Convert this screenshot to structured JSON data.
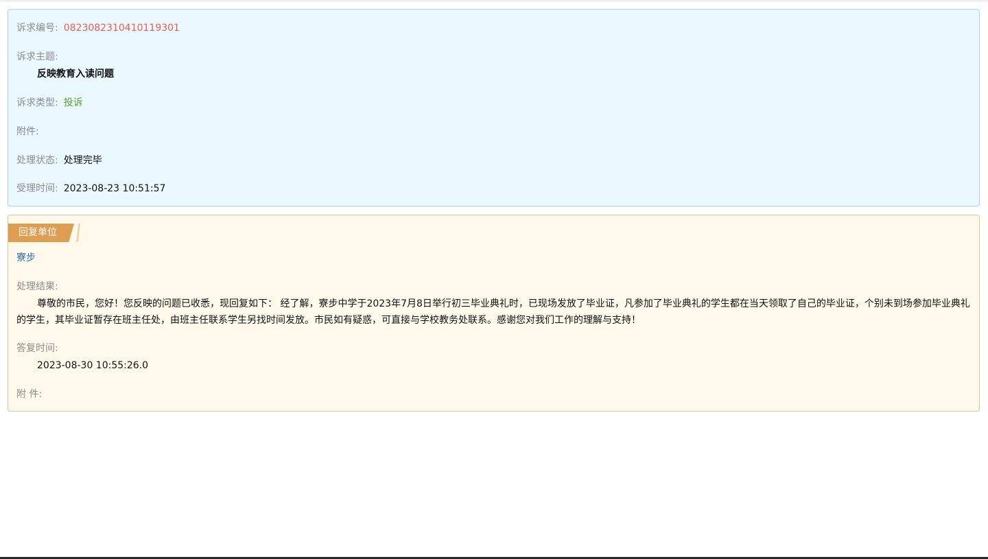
{
  "info": {
    "id_label": "诉求编号:",
    "id_value": "0823082310410119301",
    "subject_label": "诉求主题:",
    "subject_value": "反映教育入读问题",
    "type_label": "诉求类型:",
    "type_value": "投诉",
    "attachment_label": "附件:",
    "status_label": "处理状态:",
    "status_value": "处理完毕",
    "accepted_label": "受理时间:",
    "accepted_value": "2023-08-23 10:51:57"
  },
  "reply": {
    "ribbon_label": "回复单位",
    "unit_name": "寮步",
    "result_label": "处理结果:",
    "result_text": "尊敬的市民，您好！您反映的问题已收悉，现回复如下： 经了解，寮步中学于2023年7月8日举行初三毕业典礼时，已现场发放了毕业证，凡参加了毕业典礼的学生都在当天领取了自己的毕业证，个别未到场参加毕业典礼的学生，其毕业证暂存在班主任处，由班主任联系学生另找时间发放。市民如有疑惑，可直接与学校教务处联系。感谢您对我们工作的理解与支持！",
    "reply_time_label": "答复时间:",
    "reply_time_value": "2023-08-30 10:55:26.0",
    "attachment_label": "附 件:"
  },
  "colors": {
    "info_bg": "#eaf8ff",
    "info_border": "#a9d3e6",
    "reply_bg": "#fff9ec",
    "reply_border": "#e4c68f",
    "ribbon": "#dd9e52",
    "id_value": "#f05a4f",
    "type_value": "#5aa02c",
    "unit_link": "#2a6db5"
  }
}
